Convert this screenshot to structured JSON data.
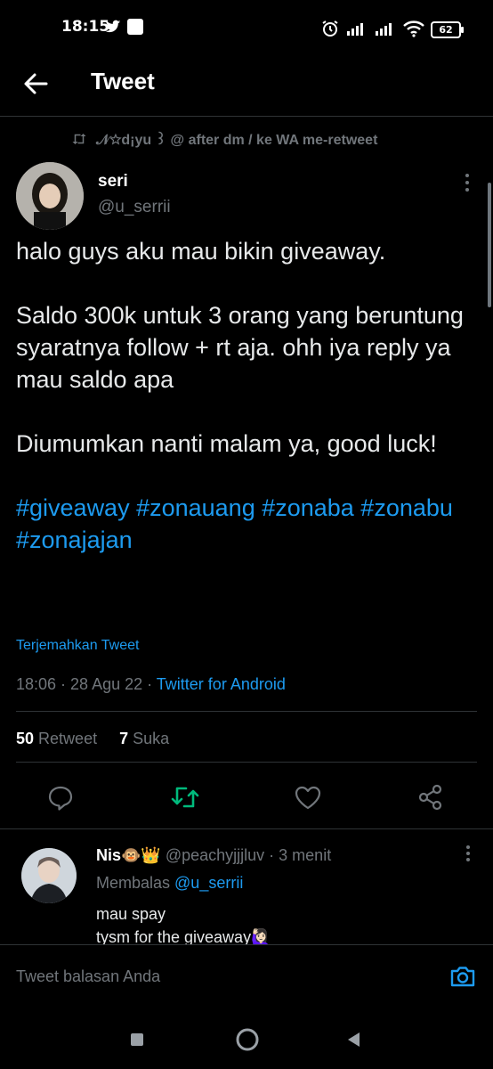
{
  "status_bar": {
    "time": "18:15",
    "battery": "62"
  },
  "header": {
    "title": "Tweet"
  },
  "retweet_context": {
    "text": "𝒩☆d¡yu ꒱ @ after dm / ke WA me-retweet"
  },
  "tweet": {
    "author_name": "seri",
    "author_handle": "@u_serrii",
    "lines_p1": "halo guys aku mau bikin giveaway.",
    "lines_p2": "Saldo 300k untuk 3 orang yang beruntung syaratnya follow + rt aja. ohh iya reply ya mau saldo apa",
    "lines_p3": "Diumumkan nanti malam ya, good luck!",
    "hashtags": "#giveaway #zonauang #zonaba #zonabu #zonajajan",
    "translate": "Terjemahkan Tweet",
    "timestamp": "18:06 · 28 Agu 22 · ",
    "source": "Twitter for Android",
    "retweet_count": "50",
    "retweet_label": "Retweet",
    "like_count": "7",
    "like_label": "Suka"
  },
  "reply": {
    "name": "Nis🐵👑",
    "handle_time": " @peachyjjjluv · 3 menit",
    "replying_label": "Membalas ",
    "replying_to": "@u_serrii",
    "text_line1": "mau spay",
    "text_line2": "tysm for the giveaway🙋🏻‍♀️"
  },
  "compose": {
    "placeholder": "Tweet balasan Anda"
  },
  "colors": {
    "accent": "#1d9bf0",
    "retweet_active": "#00ba7c",
    "muted": "#71767b"
  },
  "icons": [
    "back-arrow-icon",
    "retweet-icon",
    "more-vertical-icon",
    "reply-icon",
    "like-icon",
    "share-icon",
    "camera-icon",
    "square-nav-icon",
    "circle-nav-icon",
    "triangle-back-nav-icon"
  ]
}
